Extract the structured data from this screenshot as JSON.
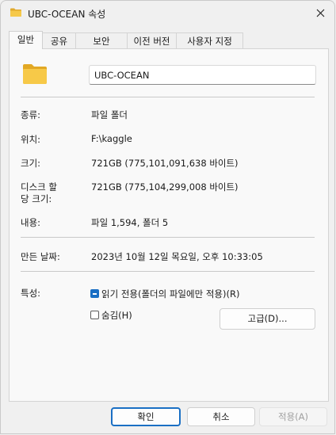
{
  "window": {
    "title": "UBC-OCEAN 속성"
  },
  "tabs": [
    {
      "label": "일반",
      "active": true
    },
    {
      "label": "공유",
      "active": false
    },
    {
      "label": "보안",
      "active": false
    },
    {
      "label": "이전 버전",
      "active": false
    },
    {
      "label": "사용자 지정",
      "active": false
    }
  ],
  "general": {
    "folder_name": "UBC-OCEAN",
    "type_label": "종류:",
    "type_value": "파일 폴더",
    "location_label": "위치:",
    "location_value": "F:\\kaggle",
    "size_label": "크기:",
    "size_value": "721GB (775,101,091,638 바이트)",
    "disk_size_label_1": "디스크 할",
    "disk_size_label_2": "당 크기:",
    "disk_size_value": "721GB (775,104,299,008 바이트)",
    "contains_label": "내용:",
    "contains_value": "파일 1,594, 폴더 5",
    "created_label": "만든 날짜:",
    "created_value": "2023년 10월 12일 목요일, 오후 10:33:05",
    "attributes_label": "특성:",
    "readonly_label": "읽기 전용(폴더의 파일에만 적용)(R)",
    "readonly_state": "indeterminate",
    "hidden_label": "숨김(H)",
    "hidden_state": "unchecked",
    "advanced_label": "고급(D)..."
  },
  "footer": {
    "ok_label": "확인",
    "cancel_label": "취소",
    "apply_label": "적용(A)"
  },
  "icons": {
    "title_icon": "folder-icon",
    "close_icon": "close-icon",
    "folder_icon": "folder-icon"
  },
  "colors": {
    "accent": "#1a6fc4",
    "folder": "#f4c64a",
    "background": "#f0f0f0"
  }
}
